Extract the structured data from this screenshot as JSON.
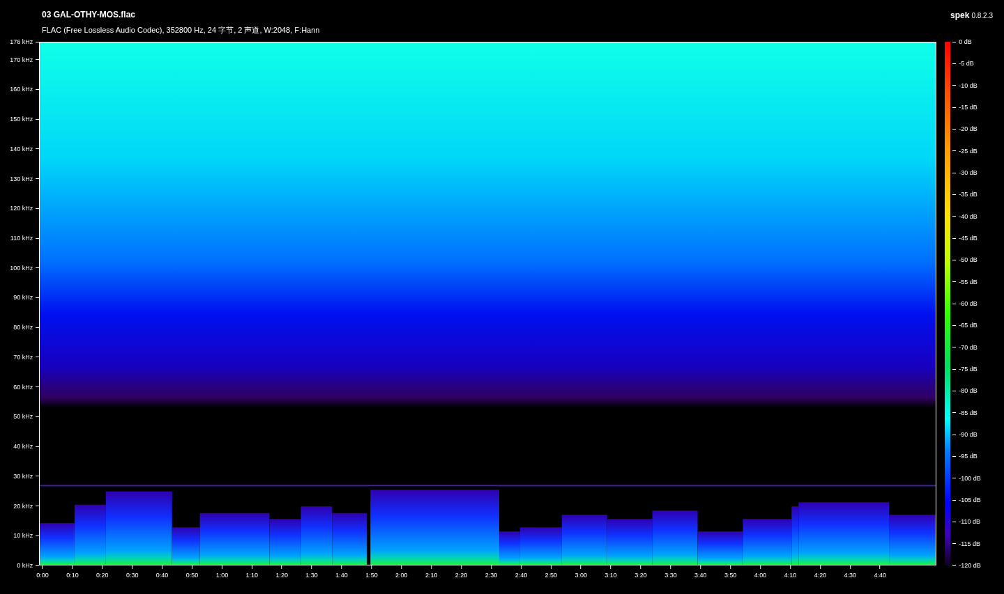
{
  "file": {
    "name": "03 GAL-OTHY-MOS.flac",
    "info": "FLAC (Free Lossless Audio Codec), 352800 Hz, 24 字节, 2 声道, W:2048, F:Hann"
  },
  "app": {
    "name": "spek",
    "version": "0.8.2.3"
  },
  "frequency_axis": [
    "176 kHz",
    "170 kHz",
    "160 kHz",
    "150 kHz",
    "140 kHz",
    "130 kHz",
    "120 kHz",
    "110 kHz",
    "100 kHz",
    "90 kHz",
    "80 kHz",
    "70 kHz",
    "60 kHz",
    "50 kHz",
    "40 kHz",
    "30 kHz",
    "20 kHz",
    "10 kHz",
    "0 kHz"
  ],
  "time_axis": [
    "0:00",
    "0:10",
    "0:20",
    "0:30",
    "0:40",
    "0:50",
    "1:00",
    "1:10",
    "1:20",
    "1:30",
    "1:40",
    "1:50",
    "2:00",
    "2:10",
    "2:20",
    "2:30",
    "2:40",
    "2:50",
    "3:00",
    "3:10",
    "3:20",
    "3:30",
    "3:40",
    "3:50",
    "4:00",
    "4:10",
    "4:20",
    "4:30",
    "4:40"
  ],
  "level_scale": [
    "0 dB",
    "-5 dB",
    "-10 dB",
    "-15 dB",
    "-20 dB",
    "-25 dB",
    "-30 dB",
    "-35 dB",
    "-40 dB",
    "-45 dB",
    "-50 dB",
    "-55 dB",
    "-60 dB",
    "-65 dB",
    "-70 dB",
    "-75 dB",
    "-80 dB",
    "-85 dB",
    "-90 dB",
    "-95 dB",
    "-100 dB",
    "-105 dB",
    "-110 dB",
    "-115 dB",
    "-120 dB"
  ]
}
